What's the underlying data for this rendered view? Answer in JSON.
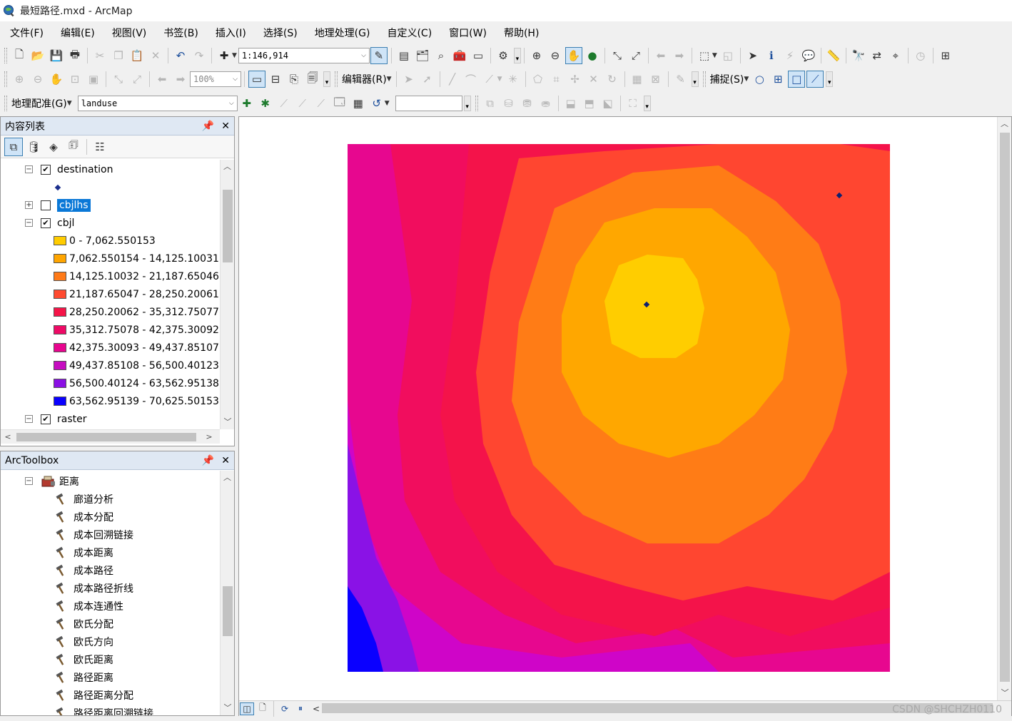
{
  "window": {
    "title": "最短路径.mxd - ArcMap"
  },
  "menu": [
    "文件(F)",
    "编辑(E)",
    "视图(V)",
    "书签(B)",
    "插入(I)",
    "选择(S)",
    "地理处理(G)",
    "自定义(C)",
    "窗口(W)",
    "帮助(H)"
  ],
  "toolbar_standard": {
    "scale": "1:146,914"
  },
  "toolbar_second": {
    "zoom_percent": "100%",
    "editor_label": "编辑器(R)",
    "snapping_label": "捕捉(S)"
  },
  "toolbar_georef": {
    "label": "地理配准(G)",
    "layer": "landuse",
    "input_value": ""
  },
  "toc": {
    "title": "内容列表",
    "layers": {
      "destination": "destination",
      "cbjlhs": "cbjlhs",
      "cbjl": "cbjl",
      "raster": "raster"
    },
    "classes": [
      {
        "label": "0 - 7,062.550153",
        "color": "#ffcc00"
      },
      {
        "label": "7,062.550154 - 14,125.10031",
        "color": "#ffa500"
      },
      {
        "label": "14,125.10032 - 21,187.65046",
        "color": "#ff7a18"
      },
      {
        "label": "21,187.65047 - 28,250.20061",
        "color": "#ff4a30"
      },
      {
        "label": "28,250.20062 - 35,312.75077",
        "color": "#f51448"
      },
      {
        "label": "35,312.75078 - 42,375.30092",
        "color": "#ee0a66"
      },
      {
        "label": "42,375.30093 - 49,437.85107",
        "color": "#e8058f"
      },
      {
        "label": "49,437.85108 - 56,500.40123",
        "color": "#c60dc0"
      },
      {
        "label": "56,500.40124 - 63,562.95138",
        "color": "#8a10e4"
      },
      {
        "label": "63,562.95139 - 70,625.50153",
        "color": "#0a00ff"
      }
    ]
  },
  "toolbox": {
    "title": "ArcToolbox",
    "toolset": "距离",
    "tools": [
      "廊道分析",
      "成本分配",
      "成本回溯链接",
      "成本距离",
      "成本路径",
      "成本路径折线",
      "成本连通性",
      "欧氏分配",
      "欧氏方向",
      "欧氏距离",
      "路径距离",
      "路径距离分配",
      "路径距离回溯链接"
    ]
  },
  "watermark": "CSDN @SHCHZH0110"
}
